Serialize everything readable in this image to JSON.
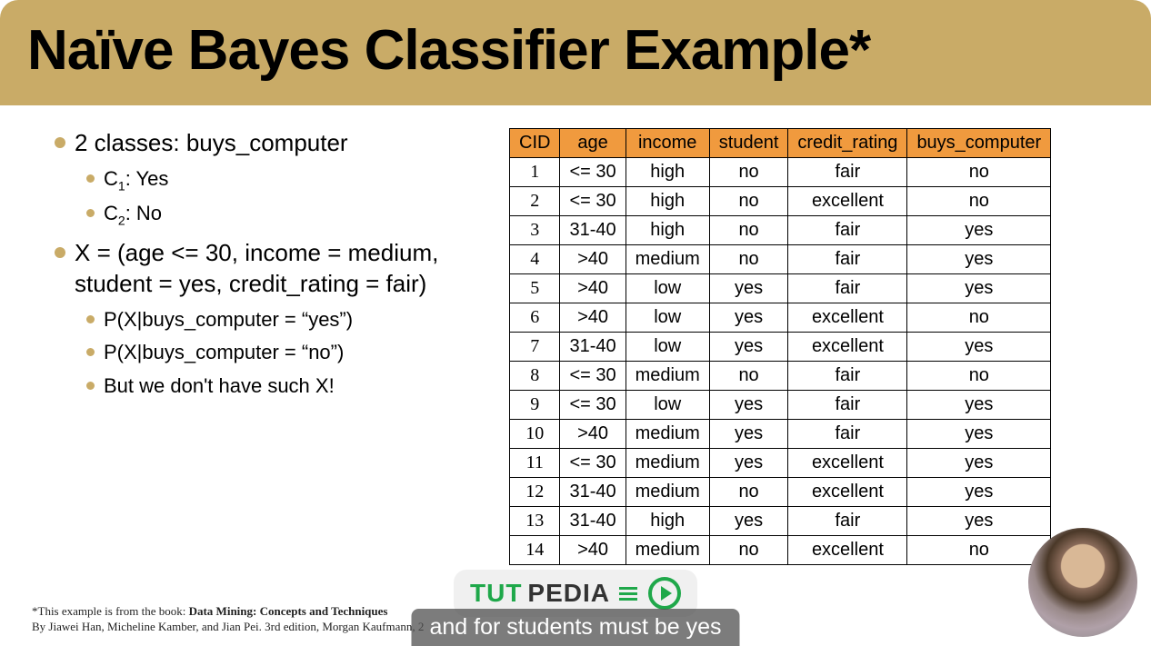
{
  "title": "Naïve Bayes Classifier Example*",
  "bullets": {
    "line1": "2 classes: buys_computer",
    "c1": "C",
    "c1sub": "1",
    "c1rest": ": Yes",
    "c2": "C",
    "c2sub": "2",
    "c2rest": ": No",
    "x_full": "X = (age <= 30, income = medium, student = yes, credit_rating = fair)",
    "px_yes": "P(X|buys_computer = “yes”)",
    "px_no": "P(X|buys_computer = “no”)",
    "but": "But we don't have such X!"
  },
  "table": {
    "headers": [
      "CID",
      "age",
      "income",
      "student",
      "credit_rating",
      "buys_computer"
    ],
    "rows": [
      [
        "1",
        "<= 30",
        "high",
        "no",
        "fair",
        "no"
      ],
      [
        "2",
        "<= 30",
        "high",
        "no",
        "excellent",
        "no"
      ],
      [
        "3",
        "31-40",
        "high",
        "no",
        "fair",
        "yes"
      ],
      [
        "4",
        ">40",
        "medium",
        "no",
        "fair",
        "yes"
      ],
      [
        "5",
        ">40",
        "low",
        "yes",
        "fair",
        "yes"
      ],
      [
        "6",
        ">40",
        "low",
        "yes",
        "excellent",
        "no"
      ],
      [
        "7",
        "31-40",
        "low",
        "yes",
        "excellent",
        "yes"
      ],
      [
        "8",
        "<= 30",
        "medium",
        "no",
        "fair",
        "no"
      ],
      [
        "9",
        "<= 30",
        "low",
        "yes",
        "fair",
        "yes"
      ],
      [
        "10",
        ">40",
        "medium",
        "yes",
        "fair",
        "yes"
      ],
      [
        "11",
        "<= 30",
        "medium",
        "yes",
        "excellent",
        "yes"
      ],
      [
        "12",
        "31-40",
        "medium",
        "no",
        "excellent",
        "yes"
      ],
      [
        "13",
        "31-40",
        "high",
        "yes",
        "fair",
        "yes"
      ],
      [
        "14",
        ">40",
        "medium",
        "no",
        "excellent",
        "no"
      ]
    ]
  },
  "footnote": {
    "l1a": "*This example is from the book: ",
    "l1b": "Data Mining: Concepts and Techniques",
    "l2": "By Jiawei Han, Micheline Kamber, and Jian Pei. 3rd edition, Morgan Kaufmann, 2"
  },
  "logo": {
    "tut": "TUT",
    "pedia": "PEDIA"
  },
  "caption": "and for students must be yes"
}
